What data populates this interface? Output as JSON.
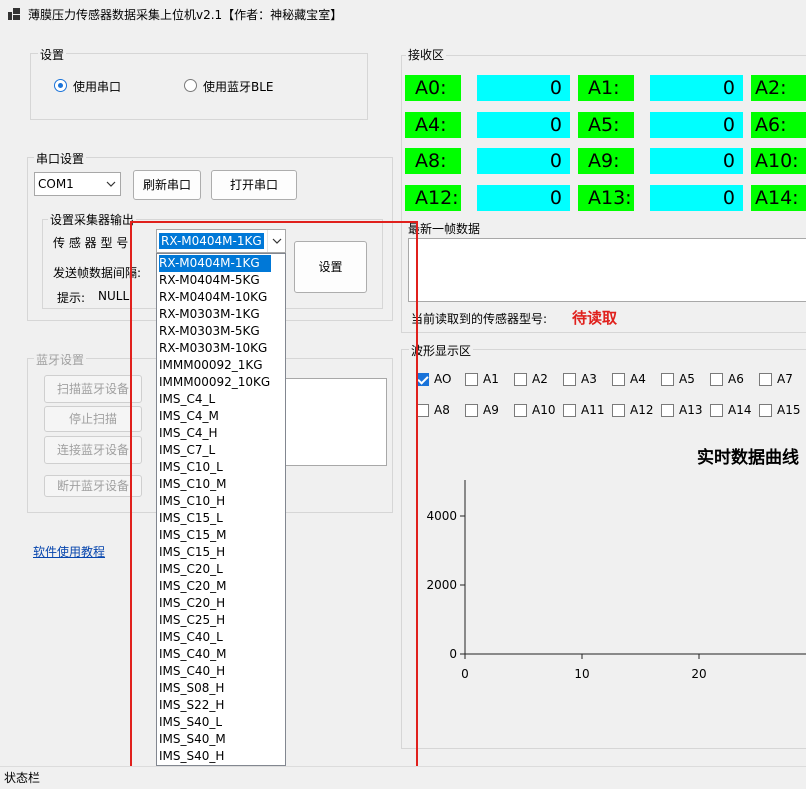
{
  "window": {
    "title": "薄膜压力传感器数据采集上位机v2.1【作者：神秘藏宝室】"
  },
  "settings": {
    "label": "设置",
    "radio_serial": "使用串口",
    "radio_ble": "使用蓝牙BLE"
  },
  "serial": {
    "label": "串口设置",
    "port_value": "COM1",
    "refresh_button": "刷新串口",
    "open_button": "打开串口"
  },
  "collector": {
    "label": "设置采集器输出",
    "model_label": "传 感 器 型 号",
    "model_value": "RX-M0404M-1KG",
    "interval_label": "发送帧数据间隔:",
    "set_button": "设置",
    "hint_label": "提示:",
    "hint_value": "NULL"
  },
  "bluetooth": {
    "label": "蓝牙设置",
    "scan_button": "扫描蓝牙设备",
    "stop_button": "停止扫描",
    "connect_button": "连接蓝牙设备",
    "disconnect_button": "断开蓝牙设备"
  },
  "tutorial_link": "软件使用教程",
  "dropdown": {
    "items": [
      "RX-M0404M-1KG",
      "RX-M0404M-5KG",
      "RX-M0404M-10KG",
      "RX-M0303M-1KG",
      "RX-M0303M-5KG",
      "RX-M0303M-10KG",
      "IMMM00092_1KG",
      "IMMM00092_10KG",
      "IMS_C4_L",
      "IMS_C4_M",
      "IMS_C4_H",
      "IMS_C7_L",
      "IMS_C10_L",
      "IMS_C10_M",
      "IMS_C10_H",
      "IMS_C15_L",
      "IMS_C15_M",
      "IMS_C15_H",
      "IMS_C20_L",
      "IMS_C20_M",
      "IMS_C20_H",
      "IMS_C25_H",
      "IMS_C40_L",
      "IMS_C40_M",
      "IMS_C40_H",
      "IMS_S08_H",
      "IMS_S22_H",
      "IMS_S40_L",
      "IMS_S40_M",
      "IMS_S40_H"
    ]
  },
  "receive": {
    "label": "接收区",
    "channels": [
      {
        "name": "A0:",
        "value": "0"
      },
      {
        "name": "A1:",
        "value": "0"
      },
      {
        "name": "A2:",
        "value": ""
      },
      {
        "name": "A4:",
        "value": "0"
      },
      {
        "name": "A5:",
        "value": "0"
      },
      {
        "name": "A6:",
        "value": ""
      },
      {
        "name": "A8:",
        "value": "0"
      },
      {
        "name": "A9:",
        "value": "0"
      },
      {
        "name": "A10:",
        "value": ""
      },
      {
        "name": "A12:",
        "value": "0"
      },
      {
        "name": "A13:",
        "value": "0"
      },
      {
        "name": "A14:",
        "value": ""
      }
    ],
    "latest_frame_label": "最新一帧数据",
    "sensor_model_label": "当前读取到的传感器型号:",
    "sensor_model_value": "待读取"
  },
  "waveform": {
    "label": "波形显示区",
    "checkboxes": [
      {
        "label": "AO",
        "checked": true
      },
      {
        "label": "A1",
        "checked": false
      },
      {
        "label": "A2",
        "checked": false
      },
      {
        "label": "A3",
        "checked": false
      },
      {
        "label": "A4",
        "checked": false
      },
      {
        "label": "A5",
        "checked": false
      },
      {
        "label": "A6",
        "checked": false
      },
      {
        "label": "A7",
        "checked": false
      },
      {
        "label": "A8",
        "checked": false
      },
      {
        "label": "A9",
        "checked": false
      },
      {
        "label": "A10",
        "checked": false
      },
      {
        "label": "A11",
        "checked": false
      },
      {
        "label": "A12",
        "checked": false
      },
      {
        "label": "A13",
        "checked": false
      },
      {
        "label": "A14",
        "checked": false
      },
      {
        "label": "A15",
        "checked": false
      }
    ]
  },
  "chart_data": {
    "type": "line",
    "title": "实时数据曲线",
    "xlabel": "",
    "ylabel": "",
    "x_ticks": [
      "0",
      "10",
      "20"
    ],
    "y_ticks": [
      "0",
      "2000",
      "4000"
    ],
    "series": []
  },
  "status_bar": "状态栏"
}
